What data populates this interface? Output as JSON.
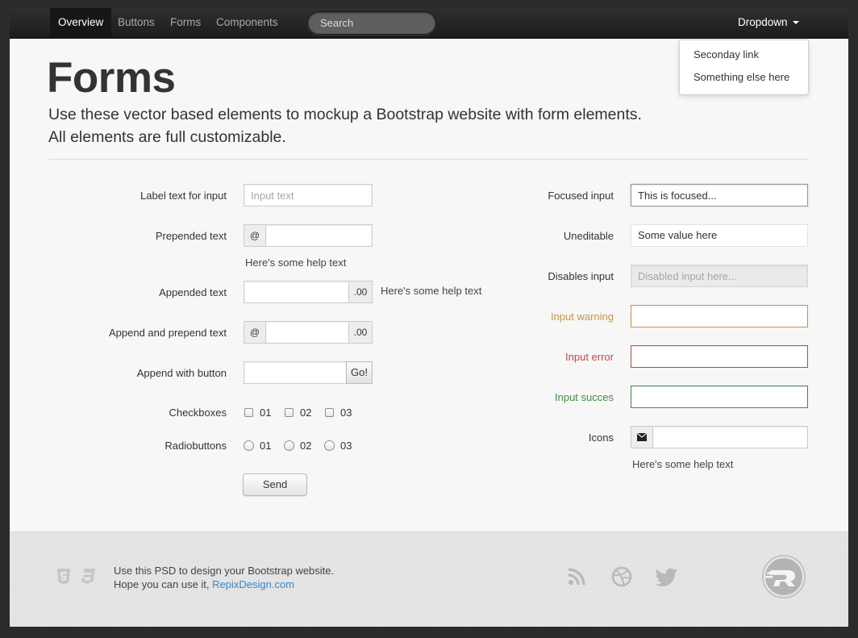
{
  "navbar": {
    "items": [
      {
        "label": "Overview",
        "active": true
      },
      {
        "label": "Buttons"
      },
      {
        "label": "Forms"
      },
      {
        "label": "Components"
      }
    ],
    "search_placeholder": "Search",
    "dropdown_label": "Dropdown",
    "dropdown_items": [
      "Seconday link",
      "Something else here"
    ]
  },
  "page": {
    "title": "Forms",
    "lead_line1": "Use these vector based elements to mockup a Bootstrap website with form elements.",
    "lead_line2": "All elements are full customizable."
  },
  "left_form": {
    "label_text_input": "Label text for input",
    "input_placeholder": "Input text",
    "prepended_label": "Prepended text",
    "prepend_addon": "@",
    "prepended_help": "Here's some help text",
    "appended_label": "Appended text",
    "append_addon": ".00",
    "appended_help": "Here's some help text",
    "append_prepend_label": "Append and prepend text",
    "append_button_label": "Append with button",
    "go_button": "Go!",
    "checkboxes_label": "Checkboxes",
    "checkboxes": [
      "01",
      "02",
      "03"
    ],
    "radios_label": "Radiobuttons",
    "radios": [
      "01",
      "02",
      "03"
    ],
    "send_button": "Send"
  },
  "right_form": {
    "focused_label": "Focused input",
    "focused_value": "This is focused...",
    "uneditable_label": "Uneditable",
    "uneditable_value": "Some value here",
    "disabled_label": "Disables input",
    "disabled_placeholder": "Disabled input here...",
    "warning_label": "Input warning",
    "error_label": "Input error",
    "success_label": "Input succes",
    "icons_label": "Icons",
    "icons_help": "Here's some help text"
  },
  "colors": {
    "warning": "#c9953f",
    "error": "#b94a48",
    "success": "#468847",
    "link": "#3a87c8"
  },
  "footer": {
    "line1": "Use this PSD to design your Bootstrap website.",
    "line2_prefix": "Hope you can use it, ",
    "link": "RepixDesign.com",
    "icons": [
      "html5-icon",
      "css3-icon",
      "rss-icon",
      "dribbble-icon",
      "twitter-icon",
      "repix-logo"
    ]
  }
}
